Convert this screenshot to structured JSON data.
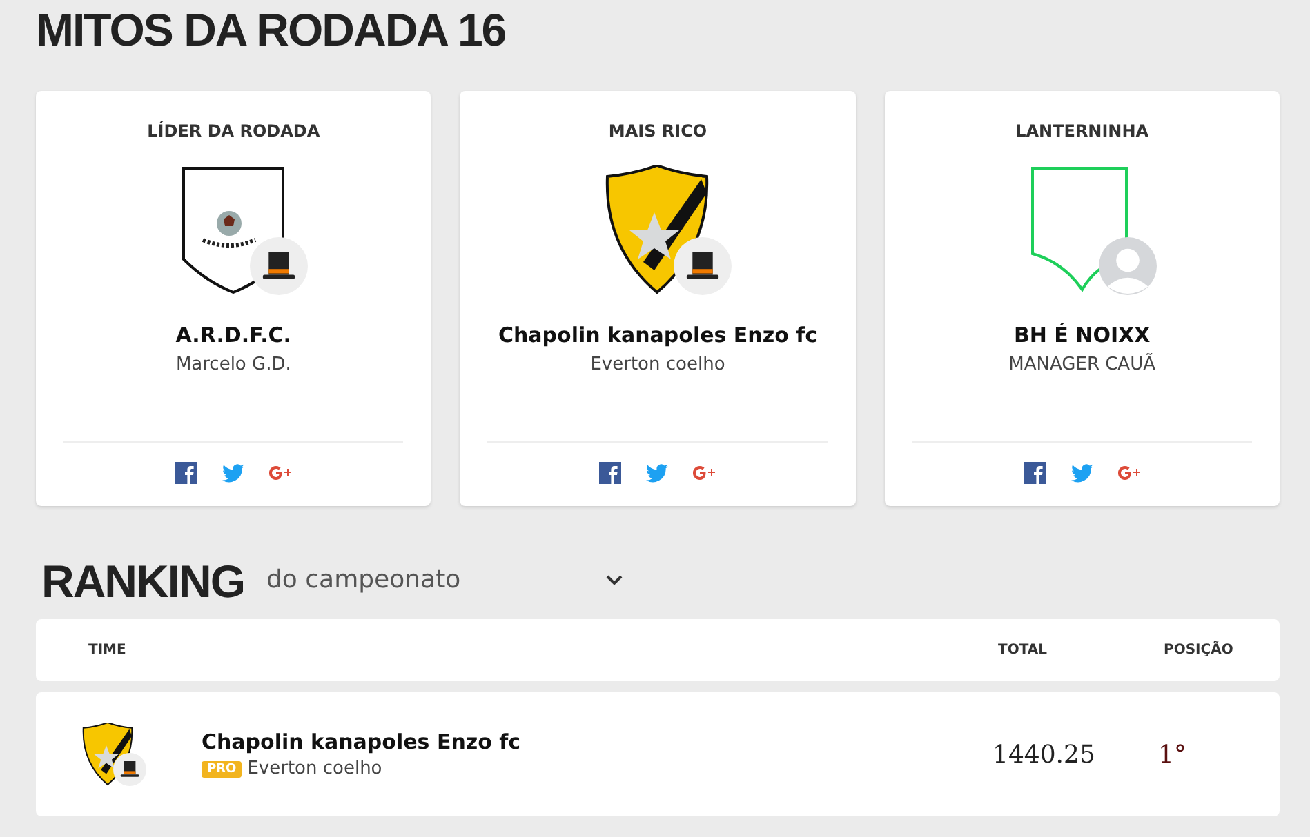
{
  "title": "MITOS DA RODADA 16",
  "highlights": [
    {
      "label": "LÍDER DA RODADA",
      "team": "A.R.D.F.C.",
      "owner": "Marcelo G.D.",
      "shield": {
        "kind": "ball"
      },
      "badge": {
        "kind": "hat"
      }
    },
    {
      "label": "MAIS RICO",
      "team": "Chapolin kanapoles Enzo fc",
      "owner": "Everton coelho",
      "shield": {
        "kind": "star"
      },
      "badge": {
        "kind": "hat"
      }
    },
    {
      "label": "LANTERNINHA",
      "team": "BH É NOIXX",
      "owner": "MANAGER CAUÃ",
      "shield": {
        "kind": "empty"
      },
      "badge": {
        "kind": "avatar"
      }
    }
  ],
  "ranking": {
    "title": "RANKING",
    "filter": "do campeonato",
    "columns": [
      "TIME",
      "TOTAL",
      "POSIÇÃO"
    ],
    "rows": [
      {
        "team": "Chapolin kanapoles Enzo fc",
        "pro": true,
        "pro_label": "PRO",
        "owner": "Everton coelho",
        "shield": {
          "kind": "star"
        },
        "badge": {
          "kind": "hat"
        },
        "total": "1440.25",
        "position": "1°"
      }
    ]
  }
}
